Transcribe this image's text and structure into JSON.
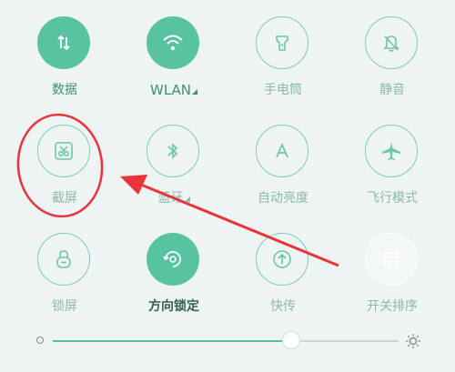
{
  "quick_settings": {
    "row1": [
      {
        "label": "数据",
        "state": "on",
        "icon": "data-arrows-icon"
      },
      {
        "label": "WLAN",
        "state": "on",
        "icon": "wifi-icon",
        "has_caret": true
      },
      {
        "label": "手电筒",
        "state": "off",
        "icon": "flashlight-icon"
      },
      {
        "label": "静音",
        "state": "off",
        "icon": "bell-mute-icon"
      }
    ],
    "row2": [
      {
        "label": "截屏",
        "state": "off",
        "icon": "screenshot-scissors-icon"
      },
      {
        "label": "蓝牙",
        "state": "off",
        "icon": "bluetooth-icon",
        "has_caret": true
      },
      {
        "label": "自动亮度",
        "state": "off",
        "icon": "auto-brightness-icon"
      },
      {
        "label": "飞行模式",
        "state": "off",
        "icon": "airplane-icon"
      }
    ],
    "row3": [
      {
        "label": "锁屏",
        "state": "off",
        "icon": "lock-icon"
      },
      {
        "label": "方向锁定",
        "state": "on",
        "icon": "rotation-lock-icon"
      },
      {
        "label": "快传",
        "state": "off",
        "icon": "fast-transfer-icon"
      },
      {
        "label": "开关排序",
        "state": "dim",
        "icon": "grid-sort-icon"
      }
    ]
  },
  "brightness": {
    "level_fraction": 0.69
  },
  "colors": {
    "accent": "#58c3a1",
    "panel_bg": "#edf4f3",
    "annotation_red": "#e8343a"
  }
}
